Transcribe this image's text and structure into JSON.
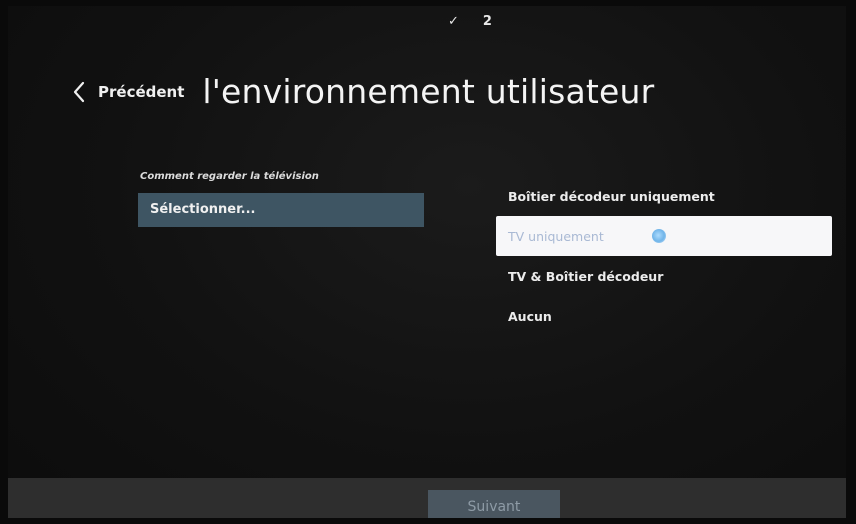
{
  "steps": {
    "completed_mark": "✓",
    "current": "2"
  },
  "header": {
    "back_label": "Précédent",
    "title": "l'environnement utilisateur"
  },
  "form": {
    "field_label": "Comment regarder la télévision",
    "select_value": "Sélectionner..."
  },
  "options": [
    {
      "label": "Boîtier décodeur uniquement",
      "selected": false
    },
    {
      "label": "TV uniquement",
      "selected": true
    },
    {
      "label": "TV & Boîtier décodeur",
      "selected": false
    },
    {
      "label": "Aucun",
      "selected": false
    }
  ],
  "footer": {
    "next_label": "Suivant"
  },
  "colors": {
    "select_bg": "#3e5563",
    "selected_option_bg": "#f7f7f9",
    "next_button_bg": "#4a5660"
  }
}
